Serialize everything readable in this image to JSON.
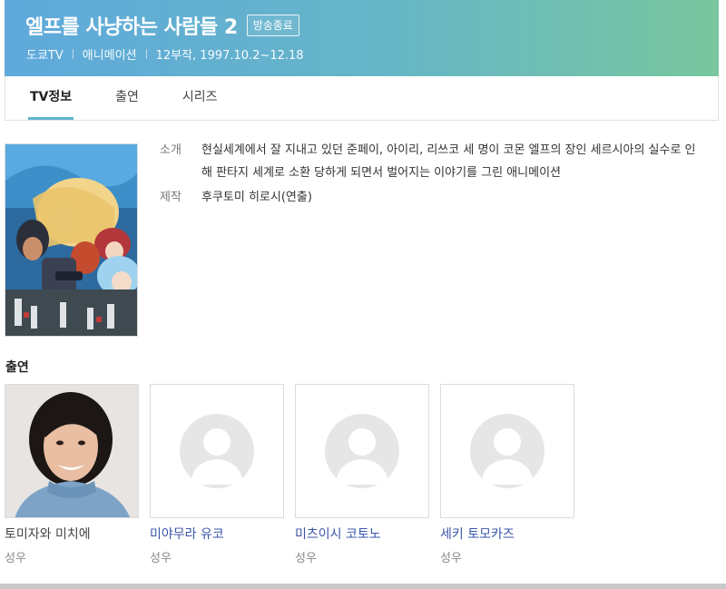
{
  "header": {
    "title": "엘프를 사냥하는 사람들 2",
    "badge": "방송종료",
    "meta": [
      "도쿄TV",
      "애니메이션",
      "12부작, 1997.10.2~12.18"
    ]
  },
  "tabs": [
    {
      "label": "TV정보",
      "active": true
    },
    {
      "label": "출연",
      "active": false
    },
    {
      "label": "시리즈",
      "active": false
    }
  ],
  "info": {
    "synopsis_label": "소개",
    "synopsis": "현실세계에서 잘 지내고 있던 준페이, 아이리, 리쓰코 세 명이 코몬 엘프의 장인 세르시아의 실수로 인해 판타지 세계로 소환 당하게 되면서 벌어지는 이야기를 그린 애니메이션",
    "production_label": "제작",
    "production": "후쿠토미 히로시(연출)"
  },
  "cast_section": {
    "title": "출연",
    "members": [
      {
        "name": "토미자와 미치에",
        "role": "성우",
        "has_photo": true,
        "linked": false
      },
      {
        "name": "미야무라 유코",
        "role": "성우",
        "has_photo": false,
        "linked": true
      },
      {
        "name": "미츠이시 코토노",
        "role": "성우",
        "has_photo": false,
        "linked": true
      },
      {
        "name": "세키 토모카즈",
        "role": "성우",
        "has_photo": false,
        "linked": true
      }
    ]
  },
  "colors": {
    "header_gradient_start": "#5fa9dc",
    "header_gradient_end": "#79c79e",
    "tab_active_underline": "#5fb6cc",
    "link": "#3a55a8"
  }
}
